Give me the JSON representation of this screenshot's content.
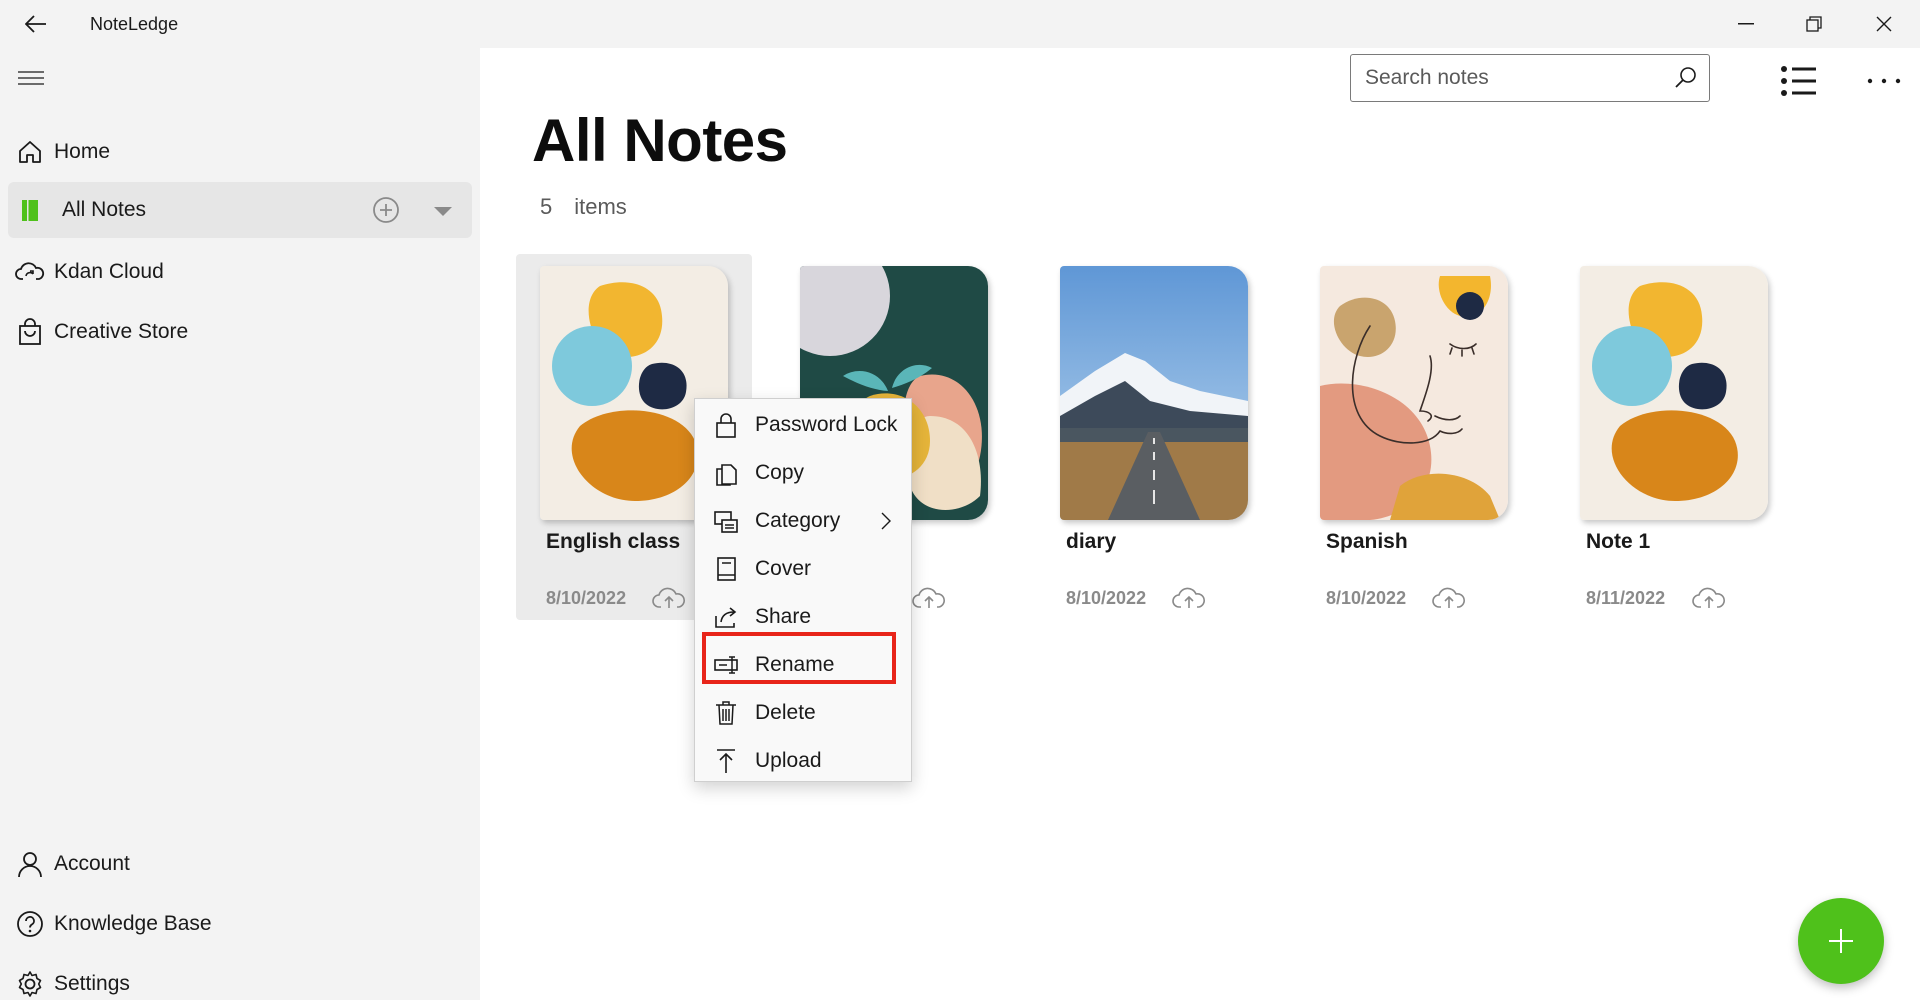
{
  "app": {
    "title": "NoteLedge"
  },
  "sidebar": {
    "items": [
      {
        "label": "Home",
        "icon": "home-icon"
      },
      {
        "label": "All Notes",
        "icon": "notebook-icon",
        "active": true
      },
      {
        "label": "Kdan Cloud",
        "icon": "cloud-sync-icon"
      },
      {
        "label": "Creative Store",
        "icon": "shopping-bag-icon"
      }
    ],
    "bottom_items": [
      {
        "label": "Account",
        "icon": "person-icon"
      },
      {
        "label": "Knowledge Base",
        "icon": "help-icon"
      },
      {
        "label": "Settings",
        "icon": "gear-icon"
      }
    ]
  },
  "search": {
    "placeholder": "Search notes",
    "value": ""
  },
  "main": {
    "title": "All Notes",
    "count": "5",
    "count_label": "items"
  },
  "notes": [
    {
      "name": "English class",
      "date": "8/10/2022",
      "cover": "abstract-shapes"
    },
    {
      "name": "",
      "date": "",
      "cover": "green-sprout"
    },
    {
      "name": "diary",
      "date": "8/10/2022",
      "cover": "mountain-road"
    },
    {
      "name": "Spanish",
      "date": "8/10/2022",
      "cover": "line-face"
    },
    {
      "name": "Note 1",
      "date": "8/11/2022",
      "cover": "abstract-shapes"
    }
  ],
  "context_menu": {
    "items": [
      {
        "label": "Password Lock",
        "icon": "lock-icon"
      },
      {
        "label": "Copy",
        "icon": "copy-icon"
      },
      {
        "label": "Category",
        "icon": "category-icon",
        "submenu": true
      },
      {
        "label": "Cover",
        "icon": "book-icon"
      },
      {
        "label": "Share",
        "icon": "share-icon"
      },
      {
        "label": "Rename",
        "icon": "rename-icon",
        "highlighted": true
      },
      {
        "label": "Delete",
        "icon": "trash-icon"
      },
      {
        "label": "Upload",
        "icon": "upload-icon"
      }
    ]
  },
  "colors": {
    "accent_green": "#4fc11b",
    "highlight_red": "#e8251a",
    "sidebar_bg": "#f3f3f3"
  }
}
